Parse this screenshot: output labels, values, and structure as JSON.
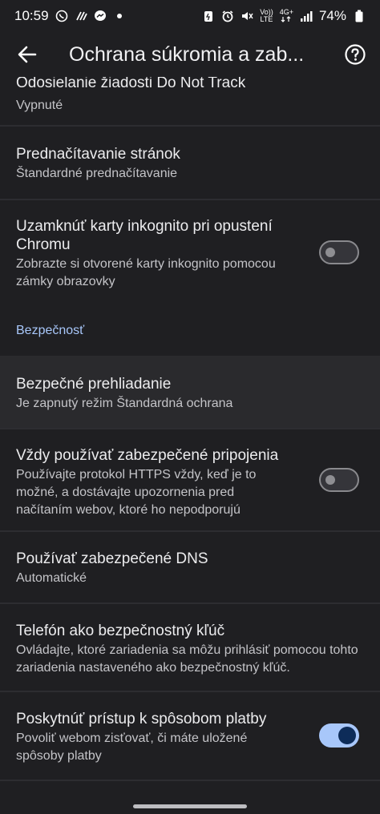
{
  "status_bar": {
    "time": "10:59",
    "battery": "74%",
    "network_top": "4G+",
    "volte": "Vo))",
    "lte": "LTE"
  },
  "appbar": {
    "title": "Ochrana súkromia a zab..."
  },
  "items": [
    {
      "title": "Odosielanie žiadosti Do Not Track",
      "subtitle": "Vypnuté"
    },
    {
      "title": "Prednačítavanie stránok",
      "subtitle": "Štandardné prednačítavanie"
    },
    {
      "title": "Uzamknúť karty inkognito pri opustení Chromu",
      "subtitle": "Zobrazte si otvorené karty inkognito pomocou zámky obrazovky",
      "toggle": false
    },
    {
      "title": "Bezpečné prehliadanie",
      "subtitle": "Je zapnutý režim Štandardná ochrana"
    },
    {
      "title": "Vždy používať zabezpečené pripojenia",
      "subtitle": "Používajte protokol HTTPS vždy, keď je to možné, a dostávajte upozornenia pred načítaním webov, ktoré ho nepodporujú",
      "toggle": false
    },
    {
      "title": "Používať zabezpečené DNS",
      "subtitle": "Automatické"
    },
    {
      "title": "Telefón ako bezpečnostný kľúč",
      "subtitle": "Ovládajte, ktoré zariadenia sa môžu prihlásiť pomocou tohto zariadenia nastaveného ako bezpečnostný kľúč."
    },
    {
      "title": "Poskytnúť prístup k spôsobom platby",
      "subtitle": "Povoliť webom zisťovať, či máte uložené spôsoby platby",
      "toggle": true
    }
  ],
  "section_label": "Bezpečnosť",
  "colors": {
    "background": "#1f1f22",
    "accent": "#a8c7fa",
    "toggle_on_knob": "#0d2c59"
  }
}
